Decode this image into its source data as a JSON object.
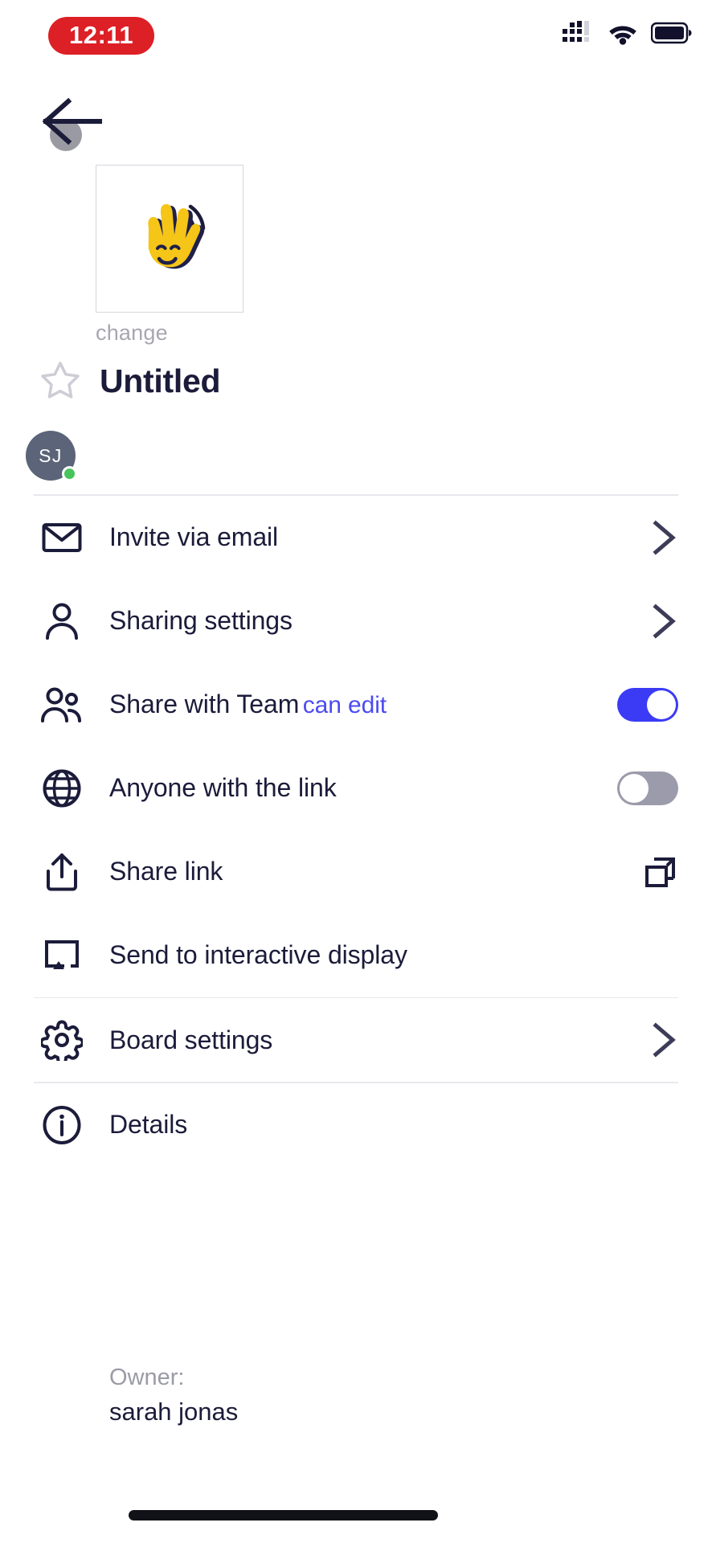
{
  "status_bar": {
    "time": "12:11",
    "signal_icon": "cellular-signal-icon",
    "wifi_icon": "wifi-icon",
    "battery_icon": "battery-icon"
  },
  "header": {
    "back_icon": "back-arrow-icon",
    "thumbnail_icon": "waving-hand-emoji",
    "change_label": "change",
    "favorite_icon": "star-outline-icon",
    "board_title": "Untitled"
  },
  "collaborators": [
    {
      "initials": "SJ",
      "status": "online"
    }
  ],
  "menu": {
    "items": [
      {
        "id": "invite-via-email",
        "label": "Invite via email",
        "icon": "envelope-icon",
        "trailing": "chevron-right-icon"
      },
      {
        "id": "sharing-settings",
        "label": "Sharing settings",
        "icon": "person-icon",
        "trailing": "chevron-right-icon"
      },
      {
        "id": "share-with-team",
        "label": "Share with Team",
        "sublabel": "can edit",
        "icon": "people-icon",
        "trailing": "toggle",
        "toggle_state": "on"
      },
      {
        "id": "anyone-with-the-link",
        "label": "Anyone with the link",
        "icon": "globe-icon",
        "trailing": "toggle",
        "toggle_state": "off"
      },
      {
        "id": "share-link",
        "label": "Share link",
        "icon": "share-upload-icon",
        "trailing": "copy-icon"
      },
      {
        "id": "send-to-interactive-display",
        "label": "Send to interactive display",
        "icon": "cast-display-icon",
        "trailing": ""
      },
      {
        "id": "board-settings",
        "label": "Board settings",
        "icon": "gear-icon",
        "trailing": "chevron-right-icon"
      },
      {
        "id": "details",
        "label": "Details",
        "icon": "info-circle-icon",
        "trailing": ""
      }
    ]
  },
  "details": {
    "owner_label": "Owner:",
    "owner_name": "sarah jonas"
  },
  "colors": {
    "accent_blue": "#3b3bf5",
    "link_blue": "#4b4bf0",
    "text_dark": "#1b1b3a",
    "muted": "#9b9ba6",
    "toggle_off": "#9b9bab",
    "online_green": "#47c45a",
    "time_pill_red": "#dd1f26",
    "avatar_bg": "#5b6478",
    "emoji_yellow": "#f5c518"
  }
}
